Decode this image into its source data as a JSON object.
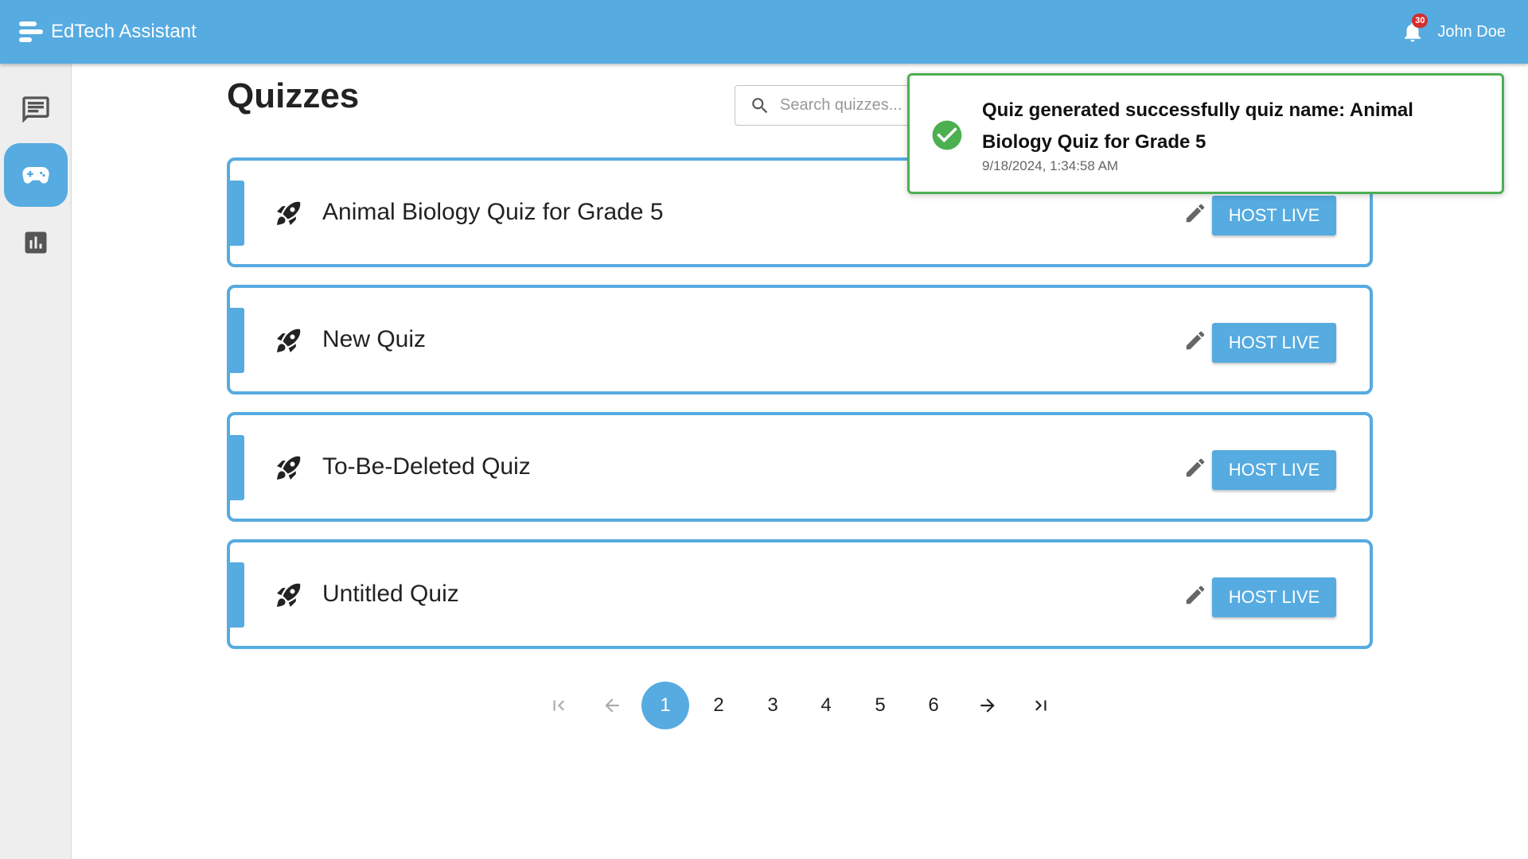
{
  "app": {
    "title": "EdTech Assistant"
  },
  "header": {
    "notification_count": "30",
    "user_name": "John Doe"
  },
  "sidebar": {
    "items": [
      {
        "name": "chat-icon",
        "active": false
      },
      {
        "name": "gamepad-icon",
        "active": true
      },
      {
        "name": "bar-chart-icon",
        "active": false
      }
    ]
  },
  "main": {
    "title": "Quizzes",
    "search": {
      "placeholder": "Search quizzes...",
      "value": ""
    },
    "quizzes": [
      {
        "name": "Animal Biology Quiz for Grade 5",
        "action": "HOST LIVE"
      },
      {
        "name": "New Quiz",
        "action": "HOST LIVE"
      },
      {
        "name": "To-Be-Deleted Quiz",
        "action": "HOST LIVE"
      },
      {
        "name": "Untitled Quiz",
        "action": "HOST LIVE"
      }
    ]
  },
  "pagination": {
    "pages": [
      "1",
      "2",
      "3",
      "4",
      "5",
      "6"
    ],
    "current": "1"
  },
  "toast": {
    "message": "Quiz generated successfully quiz name: Animal Biology Quiz for Grade 5",
    "timestamp": "9/18/2024, 1:34:58 AM"
  },
  "colors": {
    "primary": "#56abe0",
    "success": "#4caf50",
    "badge": "#d32f2f"
  }
}
